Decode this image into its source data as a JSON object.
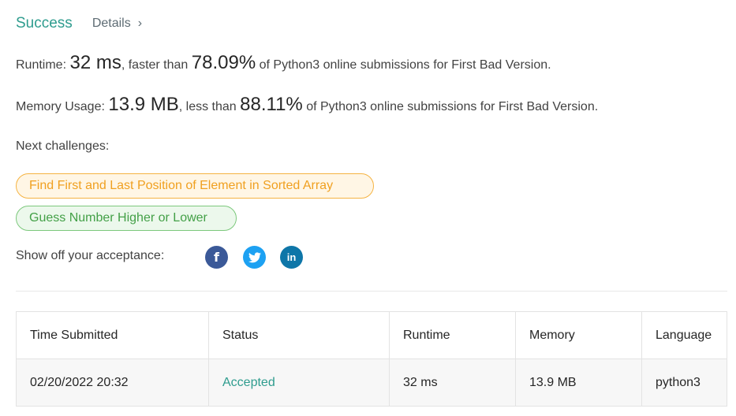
{
  "header": {
    "status_label": "Success",
    "details_label": "Details",
    "details_chevron": "›"
  },
  "runtime_stat": {
    "label": "Runtime: ",
    "value": "32 ms",
    "comparison": ", faster than ",
    "percent": "78.09%",
    "suffix": " of Python3 online submissions for First Bad Version."
  },
  "memory_stat": {
    "label": "Memory Usage: ",
    "value": "13.9 MB",
    "comparison": ", less than ",
    "percent": "88.11%",
    "suffix": " of Python3 online submissions for First Bad Version."
  },
  "next_challenges": {
    "label": "Next challenges:",
    "items": [
      {
        "title": "Find First and Last Position of Element in Sorted Array",
        "difficulty_color": "#f0a020"
      },
      {
        "title": "Guess Number Higher or Lower",
        "difficulty_color": "#43a047"
      }
    ]
  },
  "share": {
    "label": "Show off your acceptance:",
    "icons": [
      "facebook-icon",
      "twitter-icon",
      "linkedin-icon"
    ],
    "facebook_glyph": "f",
    "linkedin_glyph": "in"
  },
  "submissions_table": {
    "headers": [
      "Time Submitted",
      "Status",
      "Runtime",
      "Memory",
      "Language"
    ],
    "rows": [
      {
        "time": "02/20/2022 20:32",
        "status": "Accepted",
        "runtime": "32 ms",
        "memory": "13.9 MB",
        "language": "python3"
      }
    ]
  },
  "colors": {
    "success": "#2e9c8e",
    "medium": "#f0a020",
    "easy": "#43a047",
    "facebook": "#3b5998",
    "twitter": "#1da1f2",
    "linkedin": "#0e76a8"
  }
}
